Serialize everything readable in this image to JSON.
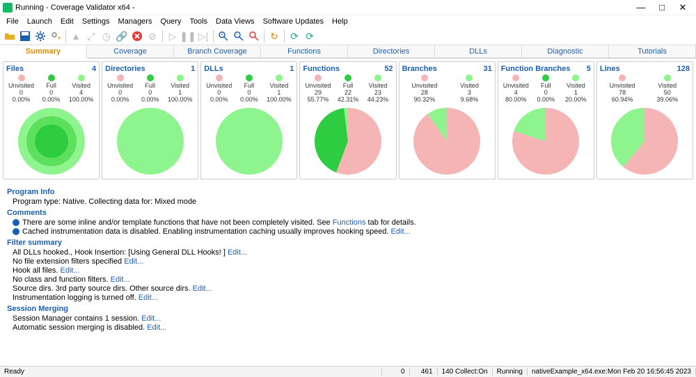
{
  "window": {
    "title": "Running - Coverage Validator x64 -"
  },
  "menu": [
    "File",
    "Launch",
    "Edit",
    "Settings",
    "Managers",
    "Query",
    "Tools",
    "Data Views",
    "Software Updates",
    "Help"
  ],
  "tabs": [
    "Summary",
    "Coverage",
    "Branch Coverage",
    "Functions",
    "Directories",
    "DLLs",
    "Diagnostic",
    "Tutorials"
  ],
  "active_tab": 0,
  "col_labels": {
    "un": "Unvisited",
    "fu": "Full",
    "vi": "Visited"
  },
  "panels": [
    {
      "title": "Files",
      "count": "4",
      "un_n": "0",
      "un_p": "0.00%",
      "fu_n": "0",
      "fu_p": "0.00%",
      "vi_n": "4",
      "vi_p": "100.00%"
    },
    {
      "title": "Directories",
      "count": "1",
      "un_n": "0",
      "un_p": "0.00%",
      "fu_n": "0",
      "fu_p": "0.00%",
      "vi_n": "1",
      "vi_p": "100.00%"
    },
    {
      "title": "DLLs",
      "count": "1",
      "un_n": "0",
      "un_p": "0.00%",
      "fu_n": "0",
      "fu_p": "0.00%",
      "vi_n": "1",
      "vi_p": "100.00%"
    },
    {
      "title": "Functions",
      "count": "52",
      "un_n": "29",
      "un_p": "55.77%",
      "fu_n": "22",
      "fu_p": "42.31%",
      "vi_n": "23",
      "vi_p": "44.23%"
    },
    {
      "title": "Branches",
      "count": "31",
      "un_n": "28",
      "un_p": "90.32%",
      "fu_n": "",
      "fu_p": "",
      "vi_n": "3",
      "vi_p": "9.68%"
    },
    {
      "title": "Function Branches",
      "count": "5",
      "un_n": "4",
      "un_p": "80.00%",
      "fu_n": "0",
      "fu_p": "0.00%",
      "vi_n": "1",
      "vi_p": "20.00%"
    },
    {
      "title": "Lines",
      "count": "128",
      "un_n": "78",
      "un_p": "60.94%",
      "fu_n": "",
      "fu_p": "",
      "vi_n": "50",
      "vi_p": "39.06%"
    }
  ],
  "chart_data": [
    {
      "type": "pie",
      "title": "Files",
      "series": [
        {
          "name": "Unvisited",
          "value": 0
        },
        {
          "name": "Full",
          "value": 0
        },
        {
          "name": "Visited",
          "value": 4
        }
      ]
    },
    {
      "type": "pie",
      "title": "Directories",
      "series": [
        {
          "name": "Unvisited",
          "value": 0
        },
        {
          "name": "Full",
          "value": 0
        },
        {
          "name": "Visited",
          "value": 1
        }
      ]
    },
    {
      "type": "pie",
      "title": "DLLs",
      "series": [
        {
          "name": "Unvisited",
          "value": 0
        },
        {
          "name": "Full",
          "value": 0
        },
        {
          "name": "Visited",
          "value": 1
        }
      ]
    },
    {
      "type": "pie",
      "title": "Functions",
      "series": [
        {
          "name": "Unvisited",
          "value": 29
        },
        {
          "name": "Full",
          "value": 22
        },
        {
          "name": "Visited",
          "value": 1
        }
      ]
    },
    {
      "type": "pie",
      "title": "Branches",
      "series": [
        {
          "name": "Unvisited",
          "value": 28
        },
        {
          "name": "Visited",
          "value": 3
        }
      ]
    },
    {
      "type": "pie",
      "title": "Function Branches",
      "series": [
        {
          "name": "Unvisited",
          "value": 4
        },
        {
          "name": "Full",
          "value": 0
        },
        {
          "name": "Visited",
          "value": 1
        }
      ]
    },
    {
      "type": "pie",
      "title": "Lines",
      "series": [
        {
          "name": "Unvisited",
          "value": 78
        },
        {
          "name": "Visited",
          "value": 50
        }
      ]
    }
  ],
  "colors": {
    "Unvisited": "#f5b5b5",
    "Full": "#2ecc40",
    "Visited": "#8ef58e"
  },
  "info": {
    "program_info_h": "Program Info",
    "program_info": "Program type: Native. Collecting data for: Mixed mode",
    "comments_h": "Comments",
    "comment1a": "There are some inline and/or template functions that have not been completely visited. See ",
    "comment1link": "Functions",
    "comment1b": " tab for details.",
    "comment2a": "Cached instrumentation data is disabled. Enabling instrumentation caching usually improves hooking speed. ",
    "comment2link": "Edit...",
    "filter_h": "Filter summary",
    "f1a": "All DLLs hooked., Hook Insertion: [Using General DLL Hooks! ] ",
    "f1l": "Edit...",
    "f2a": "No file extension filters specified ",
    "f2l": "Edit...",
    "f3a": "Hook all files. ",
    "f3l": "Edit...",
    "f4a": "No class and function filters. ",
    "f4l": "Edit...",
    "f5a": "Source dirs. 3rd party source dirs. Other source dirs.  ",
    "f5l": "Edit...",
    "f6a": "Instrumentation logging is turned off.  ",
    "f6l": "Edit...",
    "merge_h": "Session Merging",
    "m1a": "Session Manager contains 1 session. ",
    "m1l": "Edit...",
    "m2a": "Automatic session merging is disabled. ",
    "m2l": "Edit..."
  },
  "status": {
    "ready": "Ready",
    "c1": "0",
    "c2": "461",
    "c3": "140 Collect:On",
    "c4": "Running",
    "c5": "nativeExample_x64.exe:Mon Feb 20 16:56:45 2023"
  }
}
